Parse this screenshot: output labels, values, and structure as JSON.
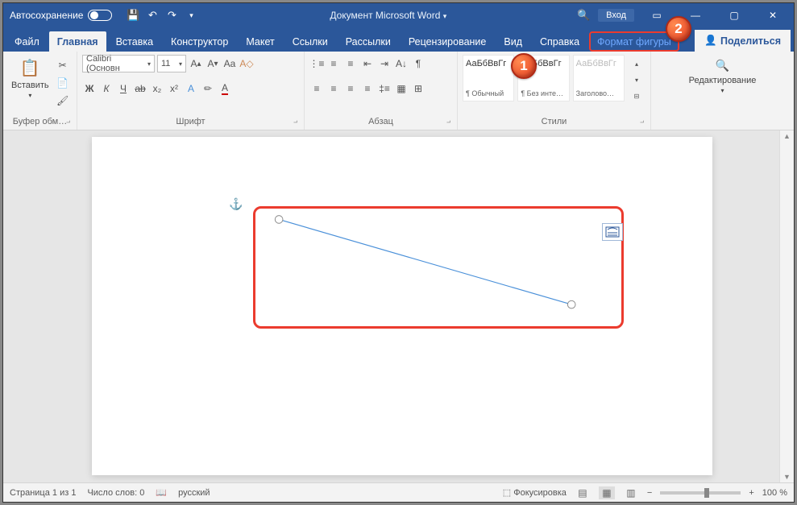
{
  "titlebar": {
    "autosave": "Автосохранение",
    "doc_title": "Документ Microsoft Word",
    "login": "Вход"
  },
  "tabs": {
    "file": "Файл",
    "home": "Главная",
    "insert": "Вставка",
    "design": "Конструктор",
    "layout": "Макет",
    "references": "Ссылки",
    "mailings": "Рассылки",
    "review": "Рецензирование",
    "view": "Вид",
    "help": "Справка",
    "shape_format": "Формат фигуры",
    "share": "Поделиться"
  },
  "ribbon": {
    "clipboard": {
      "paste": "Вставить",
      "label": "Буфер обм…"
    },
    "font": {
      "name": "Calibri (Основн",
      "size": "11",
      "label": "Шрифт"
    },
    "paragraph": {
      "label": "Абзац"
    },
    "styles": {
      "sample": "АаБбВвГг",
      "s1": "¶ Обычный",
      "s2": "¶ Без инте…",
      "s3": "Заголово…",
      "label": "Стили"
    },
    "editing": {
      "label": "Редактирование"
    }
  },
  "markers": {
    "m1": "1",
    "m2": "2"
  },
  "status": {
    "page": "Страница 1 из 1",
    "words": "Число слов: 0",
    "lang": "русский",
    "focus": "Фокусировка",
    "zoom": "100 %"
  }
}
